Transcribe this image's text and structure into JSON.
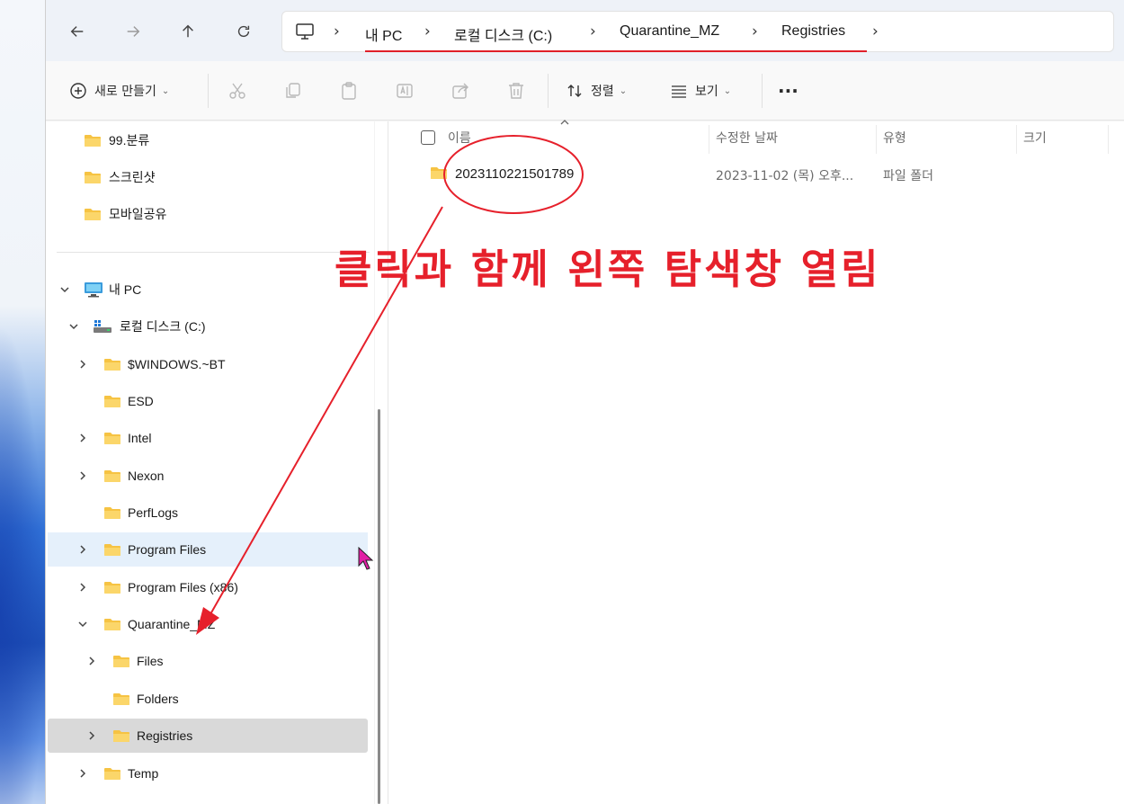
{
  "address_bar": {
    "crumbs": [
      "내 PC",
      "로컬 디스크 (C:)",
      "Quarantine_MZ",
      "Registries"
    ]
  },
  "toolbar": {
    "new_label": "새로 만들기",
    "sort_label": "정렬",
    "view_label": "보기",
    "more_label": "···"
  },
  "nav_pane": {
    "quick_items": [
      "99.분류",
      "스크린샷",
      "모바일공유"
    ],
    "this_pc_label": "내 PC",
    "drive_label": "로컬 디스크 (C:)",
    "drive_items": [
      "$WINDOWS.~BT",
      "ESD",
      "Intel",
      "Nexon",
      "PerfLogs",
      "Program Files",
      "Program Files (x86)",
      "Quarantine_MZ"
    ],
    "quarantine_children": [
      "Files",
      "Folders",
      "Registries"
    ],
    "after_item": "Temp"
  },
  "file_list": {
    "columns": {
      "name": "이름",
      "date": "수정한 날짜",
      "type": "유형",
      "size": "크기"
    },
    "rows": [
      {
        "name": "20231102215017‍89",
        "date": "2023-11-02 (목) 오후...",
        "type": "파일 폴더",
        "size": ""
      }
    ]
  },
  "annotation": {
    "text": "클릭과 함께 왼쪽 탐색창 열림",
    "color": "#e6202b"
  }
}
